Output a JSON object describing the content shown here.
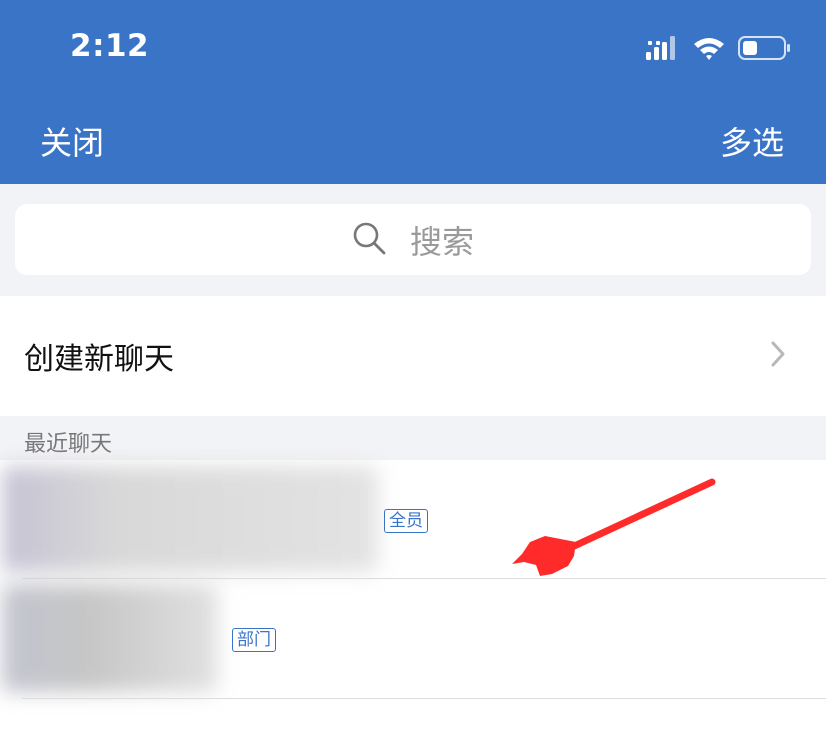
{
  "status_bar": {
    "time": "2:12",
    "icons": [
      "cellular-signal-icon",
      "wifi-icon",
      "battery-icon"
    ]
  },
  "header": {
    "close_label": "关闭",
    "multi_select_label": "多选",
    "background_color": "#3a74c7"
  },
  "search": {
    "placeholder": "搜索",
    "icon": "search-icon"
  },
  "create_chat": {
    "label": "创建新聊天",
    "icon": "chevron-right-icon"
  },
  "recent": {
    "section_label": "最近聊天",
    "items": [
      {
        "name": "",
        "tag": "全员"
      },
      {
        "name": "",
        "tag": "部门"
      }
    ]
  },
  "annotation": {
    "type": "red-pointing-arrow",
    "color": "#ff2b2b"
  }
}
